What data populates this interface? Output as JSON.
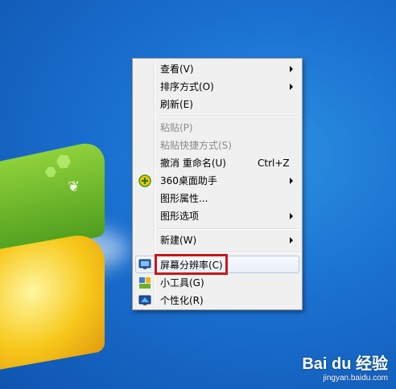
{
  "menu": {
    "items": [
      {
        "label": "查看(V)",
        "shortcut": "",
        "submenu": true,
        "disabled": false,
        "icon": ""
      },
      {
        "label": "排序方式(O)",
        "shortcut": "",
        "submenu": true,
        "disabled": false,
        "icon": ""
      },
      {
        "label": "刷新(E)",
        "shortcut": "",
        "submenu": false,
        "disabled": false,
        "icon": ""
      },
      {
        "label": "粘贴(P)",
        "shortcut": "",
        "submenu": false,
        "disabled": true,
        "icon": ""
      },
      {
        "label": "粘贴快捷方式(S)",
        "shortcut": "",
        "submenu": false,
        "disabled": true,
        "icon": ""
      },
      {
        "label": "撤消 重命名(U)",
        "shortcut": "Ctrl+Z",
        "submenu": false,
        "disabled": false,
        "icon": ""
      },
      {
        "label": "360桌面助手",
        "shortcut": "",
        "submenu": true,
        "disabled": false,
        "icon": "360-assistant-icon"
      },
      {
        "label": "图形属性...",
        "shortcut": "",
        "submenu": false,
        "disabled": false,
        "icon": ""
      },
      {
        "label": "图形选项",
        "shortcut": "",
        "submenu": true,
        "disabled": false,
        "icon": ""
      },
      {
        "label": "新建(W)",
        "shortcut": "",
        "submenu": true,
        "disabled": false,
        "icon": ""
      },
      {
        "label": "屏幕分辨率(C)",
        "shortcut": "",
        "submenu": false,
        "disabled": false,
        "icon": "monitor-icon",
        "highlighted": true
      },
      {
        "label": "小工具(G)",
        "shortcut": "",
        "submenu": false,
        "disabled": false,
        "icon": "gadgets-icon"
      },
      {
        "label": "个性化(R)",
        "shortcut": "",
        "submenu": false,
        "disabled": false,
        "icon": "personalize-icon"
      }
    ]
  },
  "watermark": {
    "brand": "Bai du 经验",
    "url": "jingyan.baidu.com"
  },
  "colors": {
    "highlight_box": "#c8181a",
    "desktop": "#1a6fcf"
  }
}
